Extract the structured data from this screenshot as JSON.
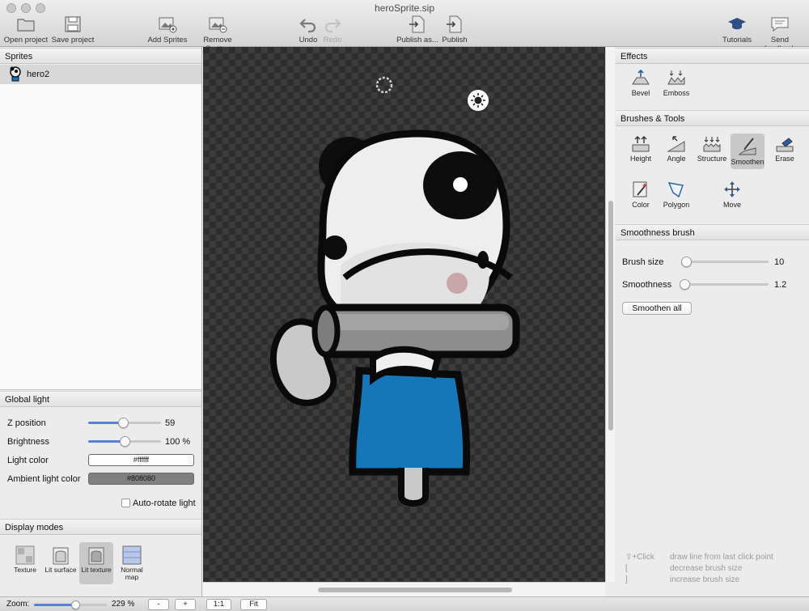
{
  "window": {
    "title": "heroSprite.sip"
  },
  "toolbar": {
    "open_project": "Open project",
    "save_project": "Save project",
    "add_sprites": "Add Sprites",
    "remove_sprites": "Remove Sprites",
    "undo": "Undo",
    "redo": "Redo",
    "publish_as": "Publish as...",
    "publish": "Publish",
    "tutorials": "Tutorials",
    "send_feedback": "Send feedback"
  },
  "sprites_panel": {
    "title": "Sprites",
    "items": [
      {
        "label": "hero2"
      }
    ]
  },
  "global_light": {
    "title": "Global light",
    "z_position": {
      "label": "Z position",
      "value": "59",
      "fraction": 0.48
    },
    "brightness": {
      "label": "Brightness",
      "value": "100 %",
      "fraction": 0.5
    },
    "light_color": {
      "label": "Light color",
      "value": "#ffffff"
    },
    "ambient_light_color": {
      "label": "Ambient light color",
      "value": "#808080"
    },
    "auto_rotate": {
      "label": "Auto-rotate light",
      "checked": false
    }
  },
  "display_modes": {
    "title": "Display modes",
    "modes": [
      {
        "label": "Texture",
        "active": false
      },
      {
        "label": "Lit surface",
        "active": false
      },
      {
        "label": "Lit texture",
        "active": true
      },
      {
        "label": "Normal map",
        "active": false
      }
    ]
  },
  "effects": {
    "title": "Effects",
    "items": [
      {
        "label": "Bevel"
      },
      {
        "label": "Emboss"
      }
    ]
  },
  "brushes_tools": {
    "title": "Brushes & Tools",
    "items": [
      {
        "label": "Height",
        "active": false
      },
      {
        "label": "Angle",
        "active": false
      },
      {
        "label": "Structure",
        "active": false
      },
      {
        "label": "Smoothen",
        "active": true
      },
      {
        "label": "Erase",
        "active": false
      },
      {
        "label": "Color",
        "active": false
      },
      {
        "label": "Polygon",
        "active": false
      },
      {
        "label": "Move",
        "active": false
      }
    ]
  },
  "smoothness_brush": {
    "title": "Smoothness brush",
    "brush_size": {
      "label": "Brush size",
      "value": "10",
      "fraction": 0.02
    },
    "smoothness": {
      "label": "Smoothness",
      "value": "1.2",
      "fraction": 0.0
    },
    "smoothen_all": "Smoothen all"
  },
  "hints": [
    {
      "key": "⇧+Click",
      "text": "draw line from last click point"
    },
    {
      "key": "[",
      "text": "decrease brush size"
    },
    {
      "key": "]",
      "text": "increase brush size"
    }
  ],
  "zoom": {
    "label": "Zoom:",
    "value": "229 %",
    "fraction": 0.57,
    "minus": "-",
    "plus": "+",
    "one_to_one": "1:1",
    "fit": "Fit"
  }
}
